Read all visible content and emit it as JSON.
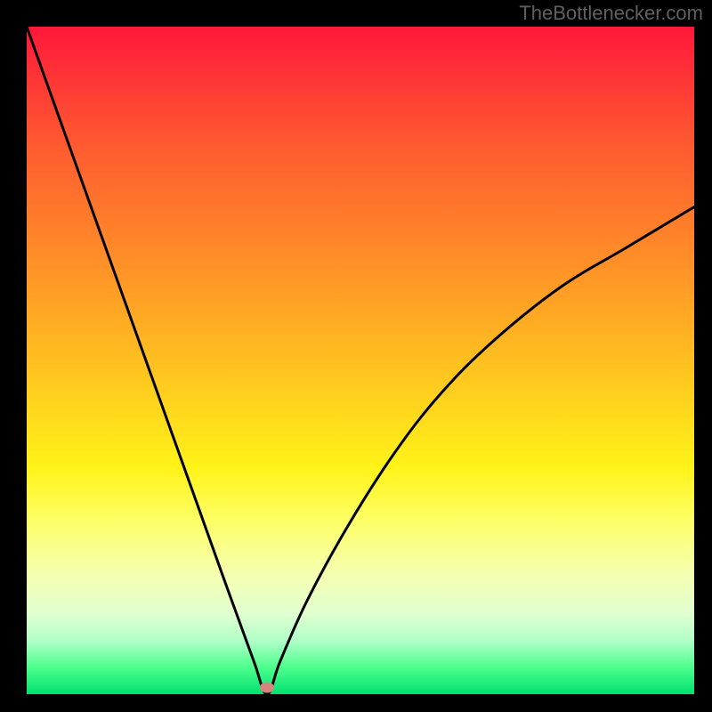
{
  "watermark": "TheBottlenecker.com",
  "chart_data": {
    "type": "line",
    "title": "",
    "xlabel": "",
    "ylabel": "",
    "xlim": [
      0,
      100
    ],
    "ylim": [
      0,
      100
    ],
    "comment": "V-shaped bottleneck curve. Vertex near x≈36, y≈0. Left branch is near-linear and steep; right branch is concave, approaching ~73% at x=100.",
    "series": [
      {
        "name": "bottleneck-curve",
        "x": [
          0,
          5,
          10,
          15,
          20,
          25,
          30,
          34,
          36,
          38,
          42,
          48,
          55,
          62,
          70,
          80,
          90,
          100
        ],
        "values": [
          100,
          86,
          72,
          58,
          44,
          30,
          16,
          5,
          0,
          5,
          14,
          25,
          36,
          45,
          53,
          61,
          67,
          73
        ]
      }
    ],
    "marker": {
      "x": 36,
      "y": 1,
      "color": "#d5847e"
    },
    "gradient_desc": "vertical red-orange-yellow-green (top high value → bottom low value)"
  }
}
